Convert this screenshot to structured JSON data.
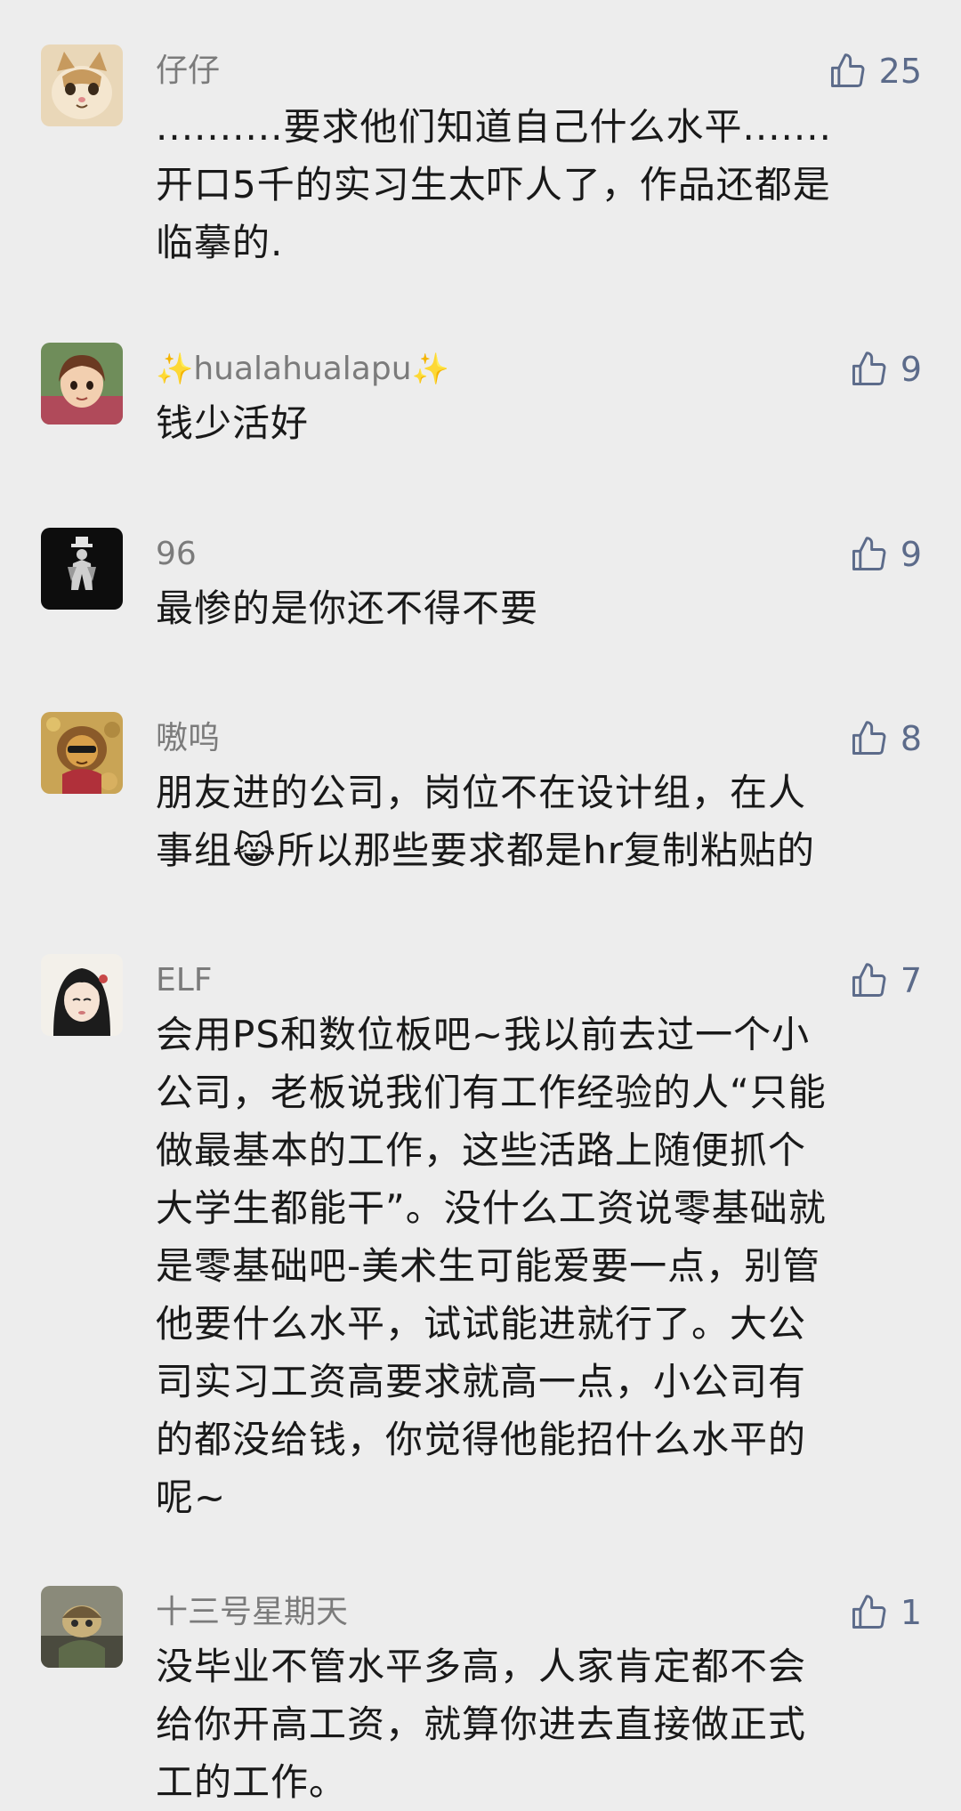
{
  "comments": [
    {
      "username": "仔仔",
      "likes": "25",
      "lines": [
        "..........要求他们知道自己什么水平.......",
        "开口5千的实习生太吓人了，作品还都是",
        "临摹的."
      ]
    },
    {
      "username": "hualahualapu",
      "likes": "9",
      "lines": [
        "钱少活好"
      ]
    },
    {
      "username": "96",
      "likes": "9",
      "lines": [
        "最惨的是你还不得不要"
      ]
    },
    {
      "username": "嗷呜",
      "likes": "8",
      "lines": [
        "朋友进的公司，岗位不在设计组，在人",
        "事组😹所以那些要求都是hr复制粘贴的"
      ]
    },
    {
      "username": "ELF",
      "likes": "7",
      "lines": [
        "会用PS和数位板吧~我以前去过一个小",
        "公司，老板说我们有工作经验的人“只能",
        "做最基本的工作，这些活路上随便抓个",
        "大学生都能干”。没什么工资说零基础就",
        "是零基础吧-美术生可能爱要一点，别管",
        "他要什么水平，试试能进就行了。大公",
        "司实习工资高要求就高一点，小公司有",
        "的都没给钱，你觉得他能招什么水平的",
        "呢~"
      ]
    },
    {
      "username": "十三号星期天",
      "likes": "1",
      "lines": [
        "没毕业不管水平多高，人家肯定都不会",
        "给你开高工资，就算你进去直接做正式",
        "工的工作。"
      ]
    }
  ],
  "icons": {
    "like": "thumbs-up-icon",
    "sparkle": "sparkles-icon"
  },
  "colors": {
    "background": "#ededed",
    "username": "#7b7b7b",
    "like": "#5c6b8a",
    "text": "#191919"
  }
}
